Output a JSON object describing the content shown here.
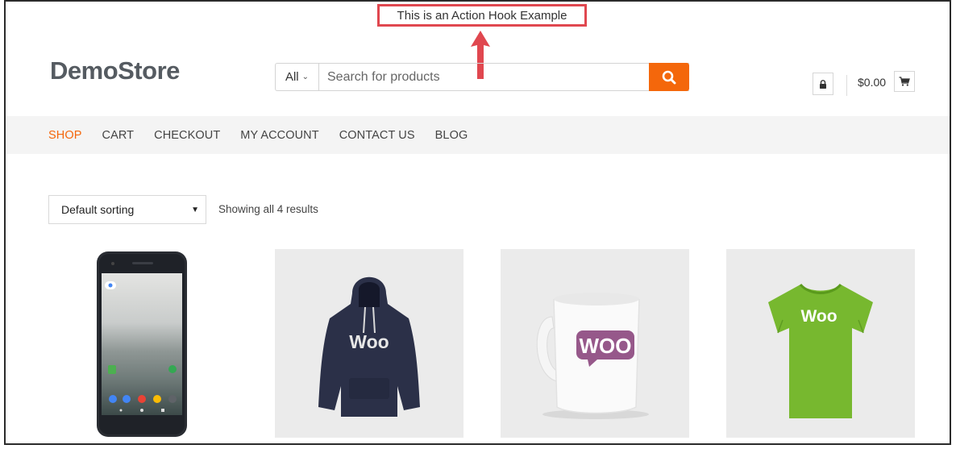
{
  "annotation": {
    "hook_text": "This is an Action Hook Example"
  },
  "header": {
    "logo": "DemoStore",
    "search": {
      "category": "All",
      "placeholder": "Search for products"
    },
    "cart_total": "$0.00"
  },
  "nav": {
    "items": [
      {
        "label": "SHOP",
        "active": true
      },
      {
        "label": "CART",
        "active": false
      },
      {
        "label": "CHECKOUT",
        "active": false
      },
      {
        "label": "MY ACCOUNT",
        "active": false
      },
      {
        "label": "CONTACT US",
        "active": false
      },
      {
        "label": "BLOG",
        "active": false
      }
    ]
  },
  "shop": {
    "sorting": "Default sorting",
    "result_count": "Showing all 4 results"
  },
  "products": [
    {
      "name": "phone",
      "icon": "smartphone-image"
    },
    {
      "name": "hoodie",
      "icon": "hoodie-image",
      "print": "Woo"
    },
    {
      "name": "mug",
      "icon": "mug-image",
      "print": "WOO"
    },
    {
      "name": "tshirt",
      "icon": "tshirt-image",
      "print": "Woo"
    }
  ],
  "colors": {
    "accent": "#f4670b",
    "annotation": "#e0474f",
    "woo_purple": "#96588a",
    "tshirt_green": "#77b82f",
    "hoodie_navy": "#2b3048"
  }
}
